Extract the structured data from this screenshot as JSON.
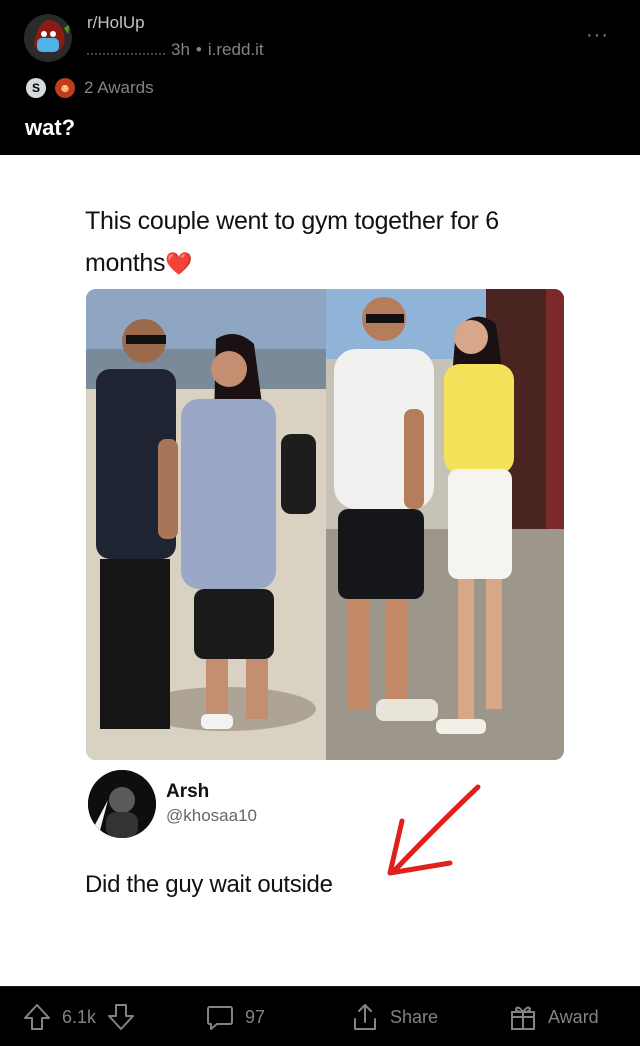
{
  "post": {
    "subreddit": "r/HolUp",
    "age": "3h",
    "separator": "•",
    "domain": "i.redd.it",
    "more_label": "···",
    "awards_label": "2 Awards",
    "title": "wat?"
  },
  "image": {
    "caption": "This couple went to gym together for 6 months",
    "caption_emoji": "❤️",
    "tweet": {
      "name": "Arsh",
      "handle": "@khosaa10",
      "text": "Did the guy wait outside"
    }
  },
  "footer": {
    "score": "6.1k",
    "comments": "97",
    "share_label": "Share",
    "award_label": "Award"
  },
  "colors": {
    "background": "#000000",
    "muted_text": "#818384",
    "arrow": "#e0201c"
  },
  "icons": [
    "avatar-icon",
    "more-icon",
    "silver-award-icon",
    "award-icon",
    "upvote-icon",
    "downvote-icon",
    "comment-icon",
    "share-icon",
    "gift-icon"
  ]
}
